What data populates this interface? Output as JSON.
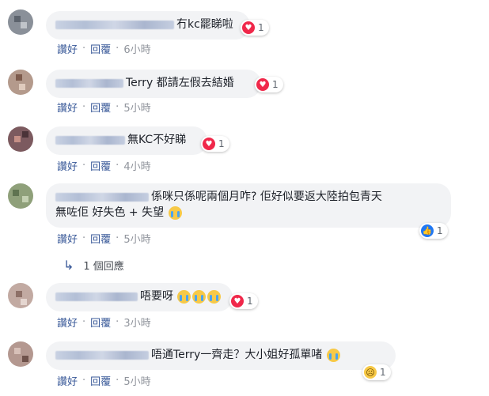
{
  "actions": {
    "like": "讚好",
    "reply": "回覆",
    "dot": "·"
  },
  "comments": [
    {
      "text": "冇kc罷睇啦",
      "reaction": {
        "icon": "heart-icon",
        "count": "1"
      },
      "time": "6小時"
    },
    {
      "text": "Terry 都請左假去結婚",
      "reaction": {
        "icon": "heart-icon",
        "count": "1"
      },
      "time": "5小時"
    },
    {
      "text": "無KC不好睇",
      "reaction": {
        "icon": "heart-icon",
        "count": "1"
      },
      "time": "4小時"
    },
    {
      "text_line1": "係咪只係呢兩個月咋? 佢好似要返大陸拍包青天",
      "text_line2": "無咗佢 好失色 + 失望",
      "reaction": {
        "icon": "like-icon",
        "count": "1"
      },
      "time": "5小時"
    },
    {
      "text": "唔要呀",
      "reaction": {
        "icon": "heart-icon",
        "count": "1"
      },
      "time": "3小時"
    },
    {
      "text": "唔通Terry一齊走？大小姐好孤單啫",
      "reaction": {
        "icon": "sad-icon",
        "count": "1"
      },
      "time": "5小時"
    }
  ],
  "replies_link": "1 個回應",
  "colors": {
    "link": "#385898",
    "bubble": "#f2f3f5",
    "heart": "#f0284a",
    "like": "#2078f4"
  }
}
